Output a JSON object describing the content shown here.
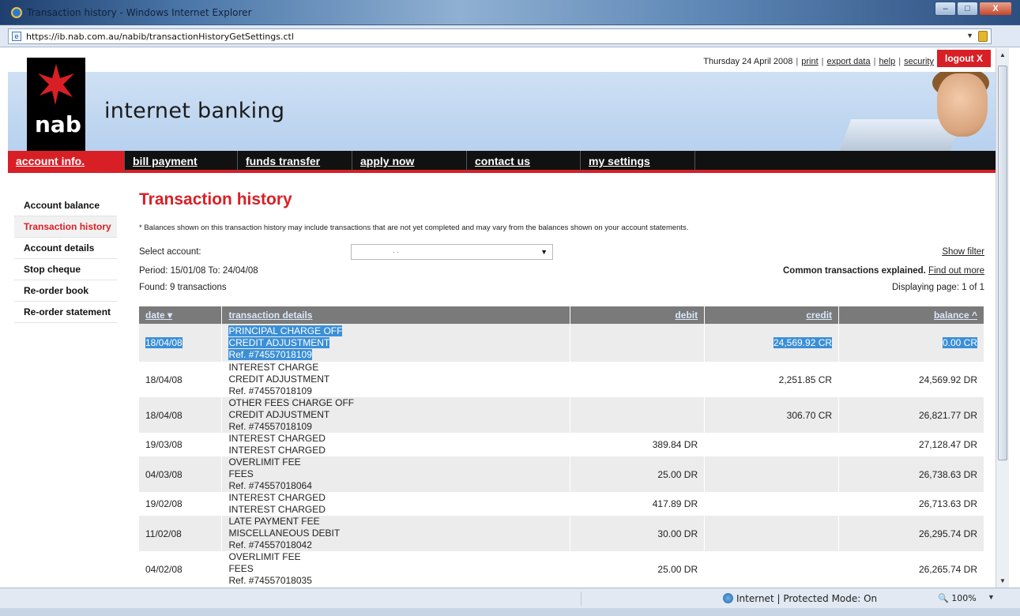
{
  "window": {
    "title": "Transaction history - Windows Internet Explorer",
    "url": "https://ib.nab.com.au/nabib/transactionHistoryGetSettings.ctl",
    "min_label": "–",
    "max_label": "□",
    "close_label": "X"
  },
  "header": {
    "date": "Thursday 24 April 2008",
    "links": [
      "print",
      "export data",
      "help",
      "security"
    ],
    "logout_label": "logout X",
    "logo_text": "nab",
    "tagline": "internet banking"
  },
  "nav": {
    "tabs": [
      {
        "label": "account info.",
        "active": true
      },
      {
        "label": "bill payment",
        "active": false
      },
      {
        "label": "funds transfer",
        "active": false
      },
      {
        "label": "apply now",
        "active": false
      },
      {
        "label": "contact us",
        "active": false
      },
      {
        "label": "my settings",
        "active": false
      }
    ]
  },
  "sidebar": {
    "items": [
      {
        "label": "Account balance",
        "active": false
      },
      {
        "label": "Transaction history",
        "active": true
      },
      {
        "label": "Account details",
        "active": false
      },
      {
        "label": "Stop cheque",
        "active": false
      },
      {
        "label": "Re-order book",
        "active": false
      },
      {
        "label": "Re-order statement",
        "active": false
      }
    ]
  },
  "main": {
    "title": "Transaction history",
    "disclaimer": "* Balances shown on this transaction history may include transactions that are not yet completed and may vary from the balances shown on your account statements.",
    "select_account_label": "Select account:",
    "select_account_value": ". .",
    "show_filter": "Show filter",
    "period": "Period: 15/01/08 To: 24/04/08",
    "common_explained": "Common transactions explained.",
    "find_out_more": "Find out more",
    "found": "Found: 9 transactions",
    "displaying": "Displaying page: 1 of 1"
  },
  "table": {
    "headers": {
      "date": "date",
      "details": "transaction details",
      "debit": "debit",
      "credit": "credit",
      "balance": "balance"
    },
    "rows": [
      {
        "date": "18/04/08",
        "details": [
          "PRINCIPAL CHARGE OFF",
          "CREDIT ADJUSTMENT",
          "Ref. #74557018109"
        ],
        "debit": "",
        "credit": "24,569.92 CR",
        "balance": "0.00 CR",
        "selected": true
      },
      {
        "date": "18/04/08",
        "details": [
          "INTEREST CHARGE",
          "CREDIT ADJUSTMENT",
          "Ref. #74557018109"
        ],
        "debit": "",
        "credit": "2,251.85 CR",
        "balance": "24,569.92 DR",
        "selected": false
      },
      {
        "date": "18/04/08",
        "details": [
          "OTHER FEES CHARGE OFF",
          "CREDIT ADJUSTMENT",
          "Ref. #74557018109"
        ],
        "debit": "",
        "credit": "306.70 CR",
        "balance": "26,821.77 DR",
        "selected": false
      },
      {
        "date": "19/03/08",
        "details": [
          "INTEREST CHARGED",
          "INTEREST CHARGED"
        ],
        "debit": "389.84 DR",
        "credit": "",
        "balance": "27,128.47 DR",
        "selected": false
      },
      {
        "date": "04/03/08",
        "details": [
          "OVERLIMIT FEE",
          "FEES",
          "Ref. #74557018064"
        ],
        "debit": "25.00 DR",
        "credit": "",
        "balance": "26,738.63 DR",
        "selected": false
      },
      {
        "date": "19/02/08",
        "details": [
          "INTEREST CHARGED",
          "INTEREST CHARGED"
        ],
        "debit": "417.89 DR",
        "credit": "",
        "balance": "26,713.63 DR",
        "selected": false
      },
      {
        "date": "11/02/08",
        "details": [
          "LATE PAYMENT FEE",
          "MISCELLANEOUS DEBIT",
          "Ref. #74557018042"
        ],
        "debit": "30.00 DR",
        "credit": "",
        "balance": "26,295.74 DR",
        "selected": false
      },
      {
        "date": "04/02/08",
        "details": [
          "OVERLIMIT FEE",
          "FEES",
          "Ref. #74557018035"
        ],
        "debit": "25.00 DR",
        "credit": "",
        "balance": "26,265.74 DR",
        "selected": false
      }
    ]
  },
  "statusbar": {
    "zone": "Internet | Protected Mode: On",
    "zoom": "100%"
  },
  "colors": {
    "brand_red": "#d91f26",
    "nav_black": "#111111",
    "table_header": "#7a7a7a",
    "selection_blue": "#3b8fd6"
  }
}
